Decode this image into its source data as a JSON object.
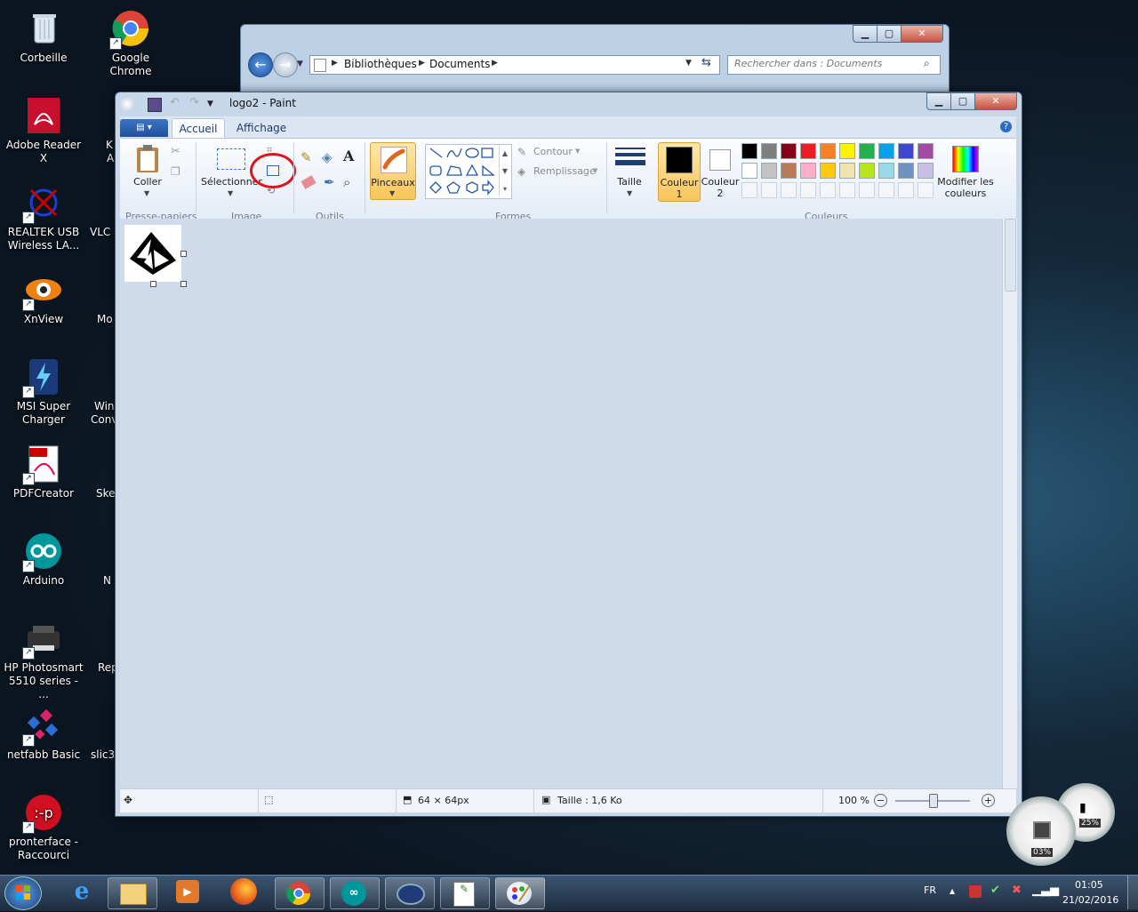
{
  "desktop": {
    "icons": [
      {
        "label": "Corbeille"
      },
      {
        "label": "Google Chrome"
      },
      {
        "label": "Adobe Reader X"
      },
      {
        "label": "REALTEK USB Wireless LA..."
      },
      {
        "label": "XnView"
      },
      {
        "label": "MSI Super Charger"
      },
      {
        "label": "PDFCreator"
      },
      {
        "label": "Arduino"
      },
      {
        "label": "HP Photosmart 5510 series - ..."
      },
      {
        "label": "netfabb Basic"
      },
      {
        "label": "pronterface - Raccourci"
      }
    ],
    "partial_labels": [
      "K",
      "A",
      "VLC",
      "Mo",
      "Win",
      "Conv",
      "Ske",
      "N",
      "Rep",
      "slic3"
    ]
  },
  "explorer": {
    "breadcrumb": [
      "Bibliothèques",
      "Documents"
    ],
    "search_placeholder": "Rechercher dans : Documents"
  },
  "paint": {
    "title": "logo2 - Paint",
    "tabs": [
      "Accueil",
      "Affichage"
    ],
    "groups": {
      "clipboard": "Presse-papiers",
      "image": "Image",
      "tools": "Outils",
      "shapes": "Formes",
      "colors": "Couleurs"
    },
    "buttons": {
      "paste": "Coller",
      "select": "Sélectionner",
      "brushes": "Pinceaux",
      "outline": "Contour",
      "fill": "Remplissage",
      "size": "Taille",
      "color1_a": "Couleur",
      "color1_b": "1",
      "color2_a": "Couleur",
      "color2_b": "2",
      "edit_colors_a": "Modifier les",
      "edit_colors_b": "couleurs"
    },
    "palette": [
      "#000000",
      "#7f7f7f",
      "#880015",
      "#ed1c24",
      "#ff7f27",
      "#fff200",
      "#22b14c",
      "#00a2e8",
      "#3f48cc",
      "#a349a4",
      "#ffffff",
      "#c3c3c3",
      "#b97a57",
      "#ffaec9",
      "#ffc90e",
      "#efe4b0",
      "#b5e61d",
      "#99d9ea",
      "#7092be",
      "#c8bfe7"
    ],
    "status": {
      "dimensions": "64 × 64px",
      "size": "Taille : 1,6 Ko",
      "zoom": "100 %"
    }
  },
  "gadget": {
    "cpu": "03%",
    "mem": "25%"
  },
  "tray": {
    "lang": "FR",
    "time": "01:05",
    "date": "21/02/2016"
  }
}
